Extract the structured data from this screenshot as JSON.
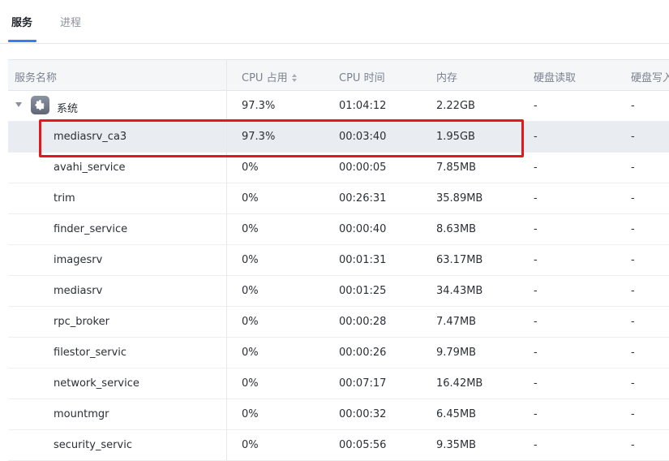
{
  "tabs": [
    {
      "label": "服务",
      "active": true
    },
    {
      "label": "进程",
      "active": false
    }
  ],
  "columns": {
    "name": "服务名称",
    "cpu": "CPU 占用",
    "cpu_time": "CPU 时间",
    "memory": "内存",
    "disk_read": "硬盘读取",
    "disk_write": "硬盘写入"
  },
  "group": {
    "name": "系统",
    "icon": "gear-icon",
    "cpu": "97.3%",
    "cpu_time": "01:04:12",
    "memory": "2.22GB",
    "disk_read": "-",
    "disk_write": "-"
  },
  "rows": [
    {
      "name": "mediasrv_ca3",
      "cpu": "97.3%",
      "cpu_time": "00:03:40",
      "memory": "1.95GB",
      "disk_read": "-",
      "disk_write": "-",
      "selected": true
    },
    {
      "name": "avahi_service",
      "cpu": "0%",
      "cpu_time": "00:00:05",
      "memory": "7.85MB",
      "disk_read": "-",
      "disk_write": "-"
    },
    {
      "name": "trim",
      "cpu": "0%",
      "cpu_time": "00:26:31",
      "memory": "35.89MB",
      "disk_read": "-",
      "disk_write": "-"
    },
    {
      "name": "finder_service",
      "cpu": "0%",
      "cpu_time": "00:00:40",
      "memory": "8.63MB",
      "disk_read": "-",
      "disk_write": "-"
    },
    {
      "name": "imagesrv",
      "cpu": "0%",
      "cpu_time": "00:01:31",
      "memory": "63.17MB",
      "disk_read": "-",
      "disk_write": "-"
    },
    {
      "name": "mediasrv",
      "cpu": "0%",
      "cpu_time": "00:01:25",
      "memory": "34.43MB",
      "disk_read": "-",
      "disk_write": "-"
    },
    {
      "name": "rpc_broker",
      "cpu": "0%",
      "cpu_time": "00:00:28",
      "memory": "7.47MB",
      "disk_read": "-",
      "disk_write": "-"
    },
    {
      "name": "filestor_servic",
      "cpu": "0%",
      "cpu_time": "00:00:26",
      "memory": "9.79MB",
      "disk_read": "-",
      "disk_write": "-"
    },
    {
      "name": "network_service",
      "cpu": "0%",
      "cpu_time": "00:07:17",
      "memory": "16.42MB",
      "disk_read": "-",
      "disk_write": "-"
    },
    {
      "name": "mountmgr",
      "cpu": "0%",
      "cpu_time": "00:00:32",
      "memory": "6.45MB",
      "disk_read": "-",
      "disk_write": "-"
    },
    {
      "name": "security_servic",
      "cpu": "0%",
      "cpu_time": "00:05:56",
      "memory": "9.35MB",
      "disk_read": "-",
      "disk_write": "-"
    }
  ],
  "colors": {
    "accent": "#3a7bf5",
    "highlight": "#e8161b",
    "selected_row": "#e9ecf1"
  }
}
